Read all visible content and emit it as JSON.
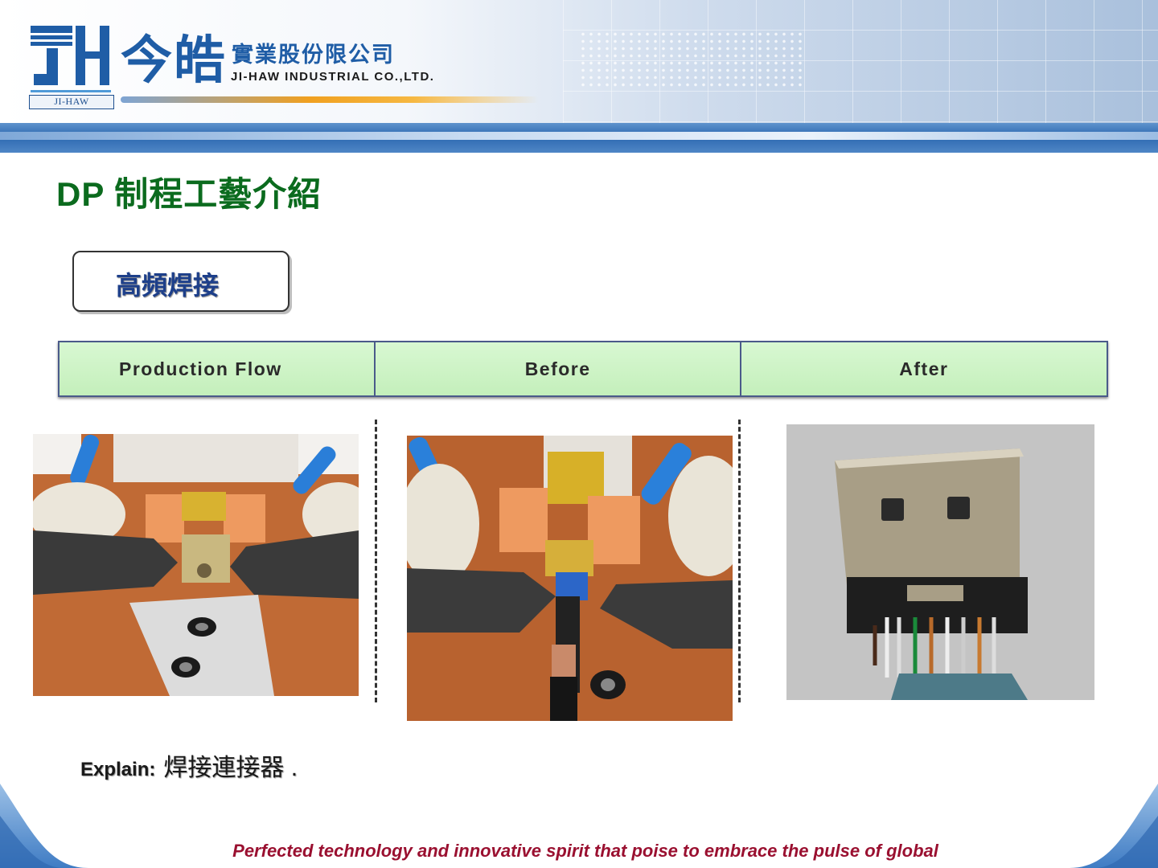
{
  "company": {
    "logo_mark": "JH",
    "logo_sub": "JI-HAW",
    "name_cn_main": "今皓",
    "name_cn_sub": "實業股份限公司",
    "name_en": "JI-HAW INDUSTRIAL CO.,LTD."
  },
  "page": {
    "title": "DP 制程工藝介紹"
  },
  "process": {
    "label": "高頻焊接"
  },
  "flow_table": {
    "headers": [
      "Production Flow",
      "Before",
      "After"
    ]
  },
  "photos": [
    {
      "subject": "welding-fixture"
    },
    {
      "subject": "welding-fixture-with-cable"
    },
    {
      "subject": "dp-connector-welded"
    }
  ],
  "explain": {
    "label": "Explain:",
    "text": "焊接連接器 ."
  },
  "footer": {
    "slogan": "Perfected technology and innovative spirit that poise to embrace the pulse of global"
  },
  "colors": {
    "title_green": "#0b6b1e",
    "banner_blue": "#2c68b0",
    "table_green": "#ccf5c4",
    "slogan_red": "#9a1030",
    "label_navy": "#1d3f8a"
  }
}
